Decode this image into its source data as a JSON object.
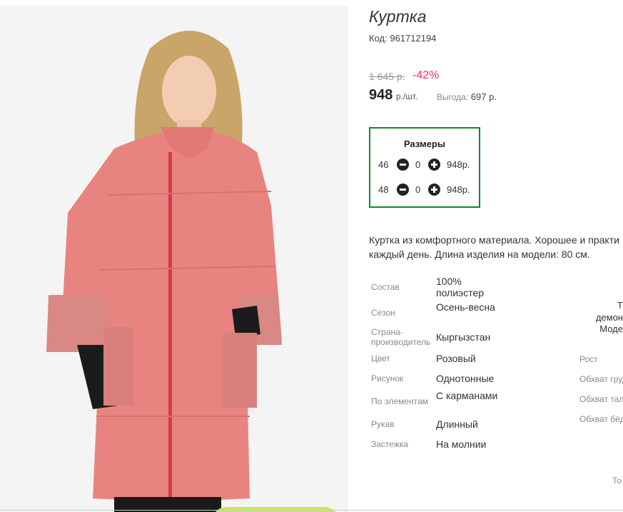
{
  "product": {
    "title": "Куртка",
    "code_label": "Код:",
    "code_value": "961712194",
    "old_price": "1 645 р.",
    "discount": "-42%",
    "price": "948",
    "price_unit": "р./шт.",
    "benefit_label": "Выгода:",
    "benefit_value": "697 р.",
    "description_line1": "Куртка из комфортного материала. Хорошее и практи",
    "description_line2": "каждый день. Длина изделия на модели: 80 см."
  },
  "sizes": {
    "title": "Размеры",
    "rows": [
      {
        "size": "46",
        "qty": "0",
        "price": "948р."
      },
      {
        "size": "48",
        "qty": "0",
        "price": "948р."
      }
    ]
  },
  "specs": [
    {
      "label": "Состав",
      "value": "100% полиэстер"
    },
    {
      "label": "Сезон",
      "value": "Осень-весна"
    },
    {
      "label": "Страна-производитель",
      "value": "Кыргызстан"
    },
    {
      "label": "Цвет",
      "value": "Розовый"
    },
    {
      "label": "Рисунок",
      "value": "Однотонные"
    },
    {
      "label": "По элементам",
      "value": "С карманами"
    },
    {
      "label": "Рукав",
      "value": "Длинный"
    },
    {
      "label": "Застежка",
      "value": "На молнии"
    }
  ],
  "model_info": {
    "line1": "Т",
    "line2": "демон",
    "line3": "Моде",
    "rows": [
      "Рост",
      "Обхват груд",
      "Обхват тал",
      "Обхват бёд"
    ],
    "bottom": "То"
  },
  "colors": {
    "accent_green": "#12872a",
    "discount_red": "#e5395a",
    "jacket_pink": "#e9837f",
    "cart_button": "#c8e84a"
  }
}
